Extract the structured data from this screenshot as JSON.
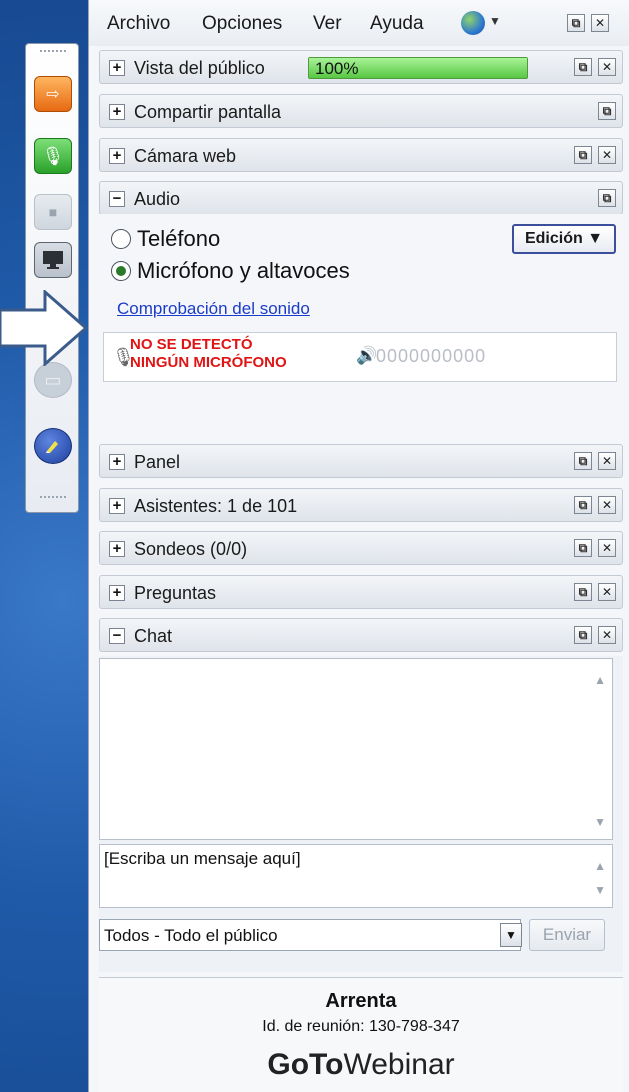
{
  "menubar": {
    "items": [
      "Archivo",
      "Opciones",
      "Ver",
      "Ayuda"
    ],
    "language_icon": "globe-icon"
  },
  "sections": {
    "public_view": {
      "label": "Vista del público",
      "progress_percent": 100,
      "progress_text": "100%"
    },
    "share_screen": {
      "label": "Compartir pantalla"
    },
    "webcam": {
      "label": "Cámara web"
    },
    "audio": {
      "label": "Audio"
    },
    "panel": {
      "label": "Panel"
    },
    "attendees": {
      "label": "Asistentes:  1 de 101"
    },
    "polls": {
      "label": "Sondeos (0/0)"
    },
    "questions": {
      "label": "Preguntas"
    },
    "chat": {
      "label": "Chat"
    }
  },
  "audio": {
    "option_phone": "Teléfono",
    "option_mic": "Micrófono y altavoces",
    "selected": "Micrófono y altavoces",
    "edit_button": "Edición ▼",
    "sound_check_link": "Comprobación del sonido",
    "mic_status_line1": "NO SE DETECTÓ",
    "mic_status_line2": "NINGÚN MICRÓFONO",
    "level_display": "0000000000"
  },
  "chat": {
    "input_placeholder": "[Escriba un mensaje aquí]",
    "recipient": "Todos - Todo el público",
    "send_button": "Enviar"
  },
  "footer": {
    "organizer": "Arrenta",
    "meeting_id": "Id. de reunión: 130-798-347",
    "logo_bold": "GoTo",
    "logo_light": "Webinar"
  },
  "colors": {
    "desktop_blue": "#1f5aa8",
    "progress_green": "#6dd65a",
    "error_red": "#e01414",
    "link_blue": "#1a3cc8"
  }
}
